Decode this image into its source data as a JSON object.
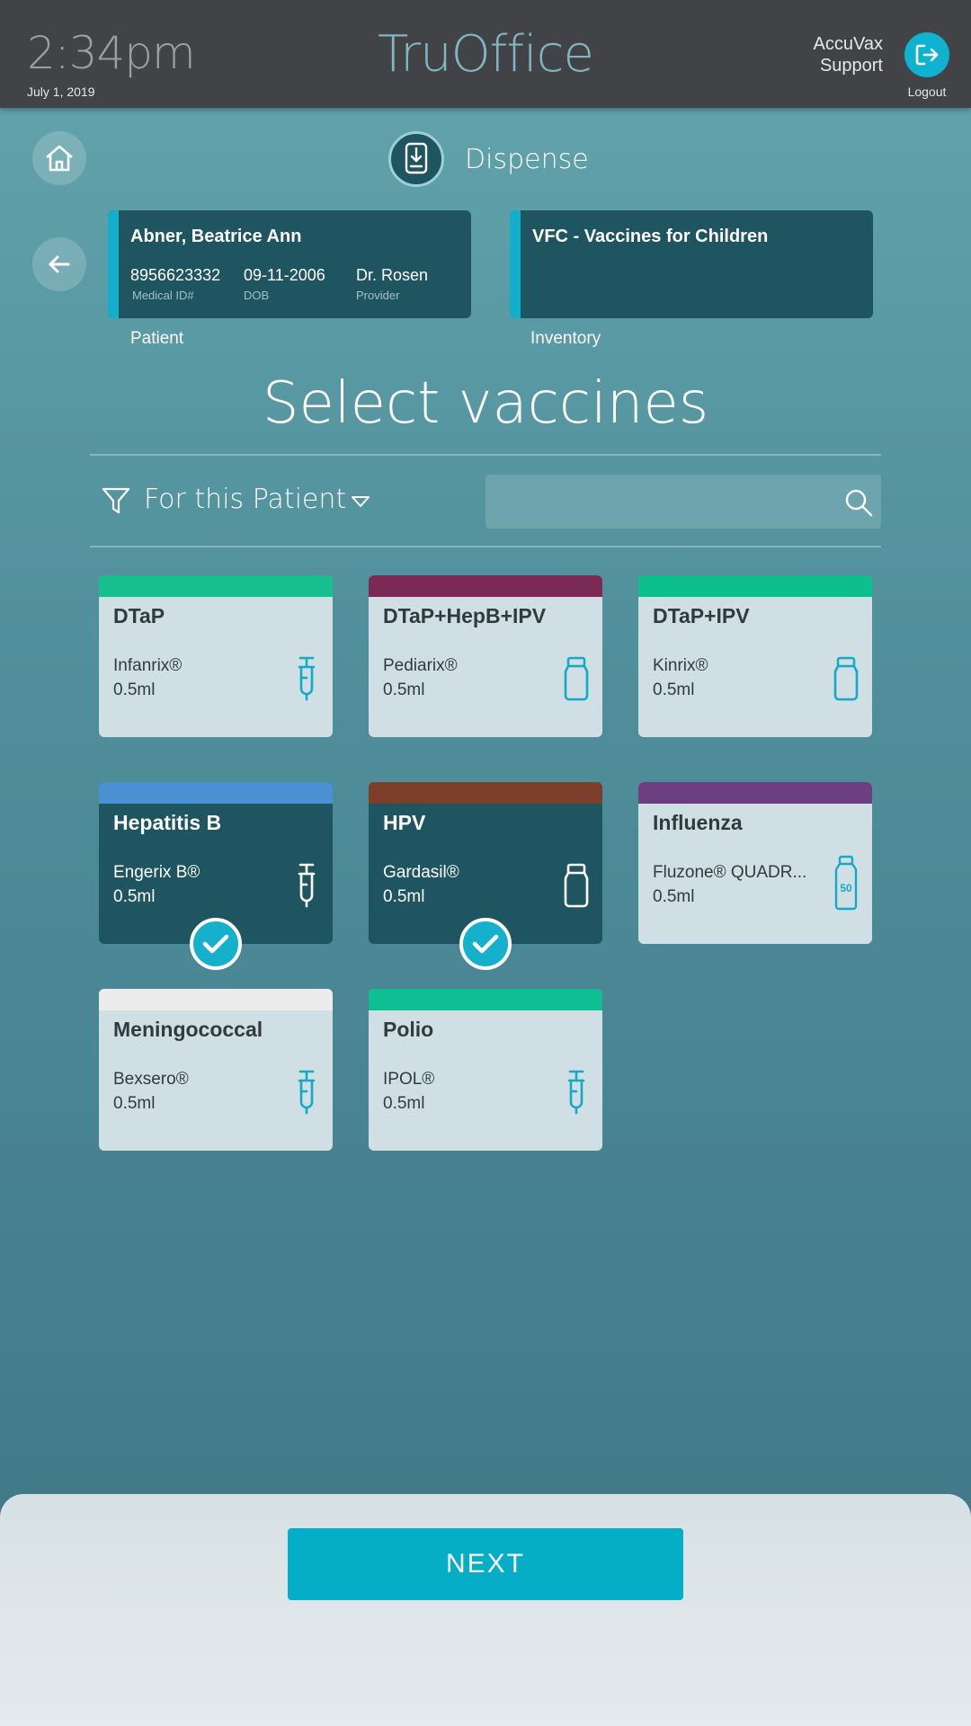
{
  "header": {
    "time": "2:34pm",
    "date": "July 1, 2019",
    "brand": "TruOffice",
    "support_line1": "AccuVax",
    "support_line2": "Support",
    "logout_label": "Logout"
  },
  "nav": {
    "mode_label": "Dispense"
  },
  "patient": {
    "name": "Abner, Beatrice Ann",
    "medical_id": "8956623332",
    "medical_id_label": "Medical ID#",
    "dob": "09-11-2006",
    "dob_label": "DOB",
    "provider": "Dr. Rosen",
    "provider_label": "Provider",
    "caption": "Patient"
  },
  "inventory": {
    "name": "VFC - Vaccines for Children",
    "caption": "Inventory"
  },
  "main": {
    "title": "Select vaccines",
    "filter_label": "For this Patient",
    "search_placeholder": ""
  },
  "vaccines": [
    {
      "name": "DTaP",
      "brand": "Infanrix®",
      "dose": "0.5ml",
      "color": "#17bf8f",
      "icon": "syringe-icon",
      "selected": false
    },
    {
      "name": "DTaP+HepB+IPV",
      "brand": "Pediarix®",
      "dose": "0.5ml",
      "color": "#7b2a55",
      "icon": "vial-icon",
      "selected": false
    },
    {
      "name": "DTaP+IPV",
      "brand": "Kinrix®",
      "dose": "0.5ml",
      "color": "#0cbf8c",
      "icon": "vial-icon",
      "selected": false
    },
    {
      "name": "Hepatitis B",
      "brand": "Engerix B®",
      "dose": "0.5ml",
      "color": "#4a90d2",
      "icon": "syringe-icon",
      "selected": true
    },
    {
      "name": "HPV",
      "brand": "Gardasil®",
      "dose": "0.5ml",
      "color": "#7d3f2b",
      "icon": "vial-icon",
      "selected": true
    },
    {
      "name": "Influenza",
      "brand": "Fluzone® QUADR...",
      "dose": "0.5ml",
      "color": "#6c3f80",
      "icon": "multi-dose-vial-icon",
      "icon_text": "50",
      "selected": false
    },
    {
      "name": "Meningococcal",
      "brand": "Bexsero®",
      "dose": "0.5ml",
      "color": "#ececec",
      "icon": "syringe-icon",
      "selected": false
    },
    {
      "name": "Polio",
      "brand": "IPOL®",
      "dose": "0.5ml",
      "color": "#0fbf93",
      "icon": "syringe-icon",
      "selected": false
    }
  ],
  "footer": {
    "next_label": "NEXT"
  },
  "colors": {
    "accent": "#0fb3cf",
    "card_dark": "#1e5560",
    "card_light": "#cfdfe4",
    "topbar": "#414346"
  }
}
